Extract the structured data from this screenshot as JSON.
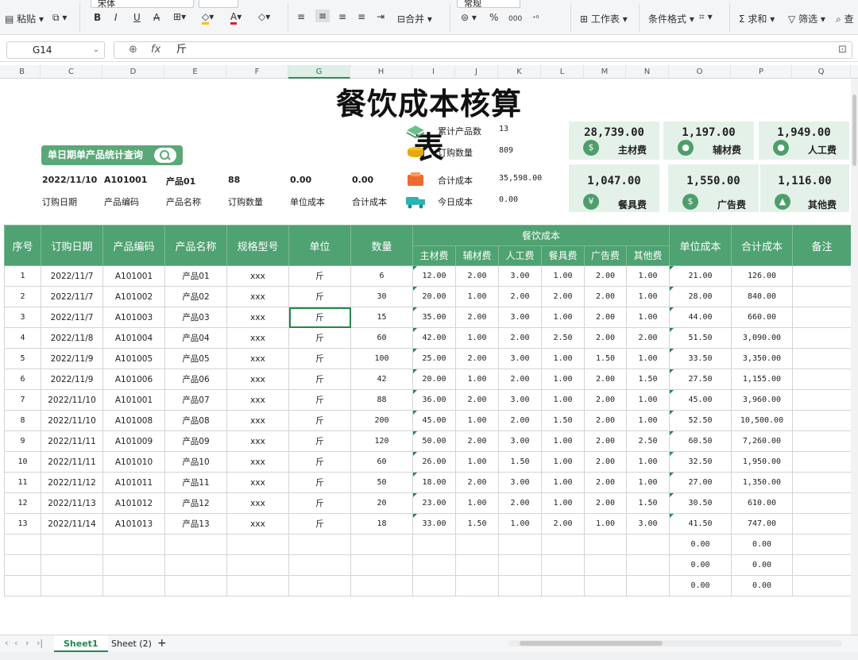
{
  "ribbon": {
    "paste_label": "粘贴",
    "font_name": "宋体",
    "merge_label": "合并",
    "number_format": "常规",
    "worksheet_label": "工作表",
    "cond_format_label": "条件格式",
    "sum_label": "求和",
    "filter_label": "筛选",
    "find_label": "查"
  },
  "formula_bar": {
    "cell_ref": "G14",
    "fx": "fx",
    "content": "斤"
  },
  "columns": [
    "B",
    "C",
    "D",
    "E",
    "F",
    "G",
    "H",
    "I",
    "J",
    "K",
    "L",
    "M",
    "N",
    "O",
    "P",
    "Q"
  ],
  "selected_column": "G",
  "title": "餐饮成本核算表",
  "query_button": "单日期单产品统计查询",
  "info": {
    "values": [
      "2022/11/10",
      "A101001",
      "产品01",
      "88",
      "0.00",
      "0.00"
    ],
    "labels": [
      "订购日期",
      "产品编码",
      "产品名称",
      "订购数量",
      "单位成本",
      "合计成本"
    ]
  },
  "stats": [
    {
      "label": "累计产品数",
      "value": "13"
    },
    {
      "label": "订购数量",
      "value": "809"
    },
    {
      "label": "合计成本",
      "value": "35,598.00"
    },
    {
      "label": "今日成本",
      "value": "0.00"
    }
  ],
  "cards": [
    {
      "value": "28,739.00",
      "label": "主材费",
      "icon": "$"
    },
    {
      "value": "1,197.00",
      "label": "辅材费",
      "icon": "●"
    },
    {
      "value": "1,949.00",
      "label": "人工费",
      "icon": "●"
    },
    {
      "value": "1,047.00",
      "label": "餐具费",
      "icon": "¥"
    },
    {
      "value": "1,550.00",
      "label": "广告费",
      "icon": "$"
    },
    {
      "value": "1,116.00",
      "label": "其他费",
      "icon": "▲"
    }
  ],
  "table": {
    "headers": [
      "序号",
      "订购日期",
      "产品编码",
      "产品名称",
      "规格型号",
      "单位",
      "数量",
      "餐饮成本",
      "单位成本",
      "合计成本",
      "备注"
    ],
    "sub_headers": [
      "主材费",
      "辅材费",
      "人工费",
      "餐具费",
      "广告费",
      "其他费"
    ],
    "rows": [
      [
        "1",
        "2022/11/7",
        "A101001",
        "产品01",
        "xxx",
        "斤",
        "6",
        "12.00",
        "2.00",
        "3.00",
        "1.00",
        "2.00",
        "1.00",
        "21.00",
        "126.00",
        ""
      ],
      [
        "2",
        "2022/11/7",
        "A101002",
        "产品02",
        "xxx",
        "斤",
        "30",
        "20.00",
        "1.00",
        "2.00",
        "2.00",
        "2.00",
        "1.00",
        "28.00",
        "840.00",
        ""
      ],
      [
        "3",
        "2022/11/7",
        "A101003",
        "产品03",
        "xxx",
        "斤",
        "15",
        "35.00",
        "2.00",
        "3.00",
        "1.00",
        "2.00",
        "1.00",
        "44.00",
        "660.00",
        ""
      ],
      [
        "4",
        "2022/11/8",
        "A101004",
        "产品04",
        "xxx",
        "斤",
        "60",
        "42.00",
        "1.00",
        "2.00",
        "2.50",
        "2.00",
        "2.00",
        "51.50",
        "3,090.00",
        ""
      ],
      [
        "5",
        "2022/11/9",
        "A101005",
        "产品05",
        "xxx",
        "斤",
        "100",
        "25.00",
        "2.00",
        "3.00",
        "1.00",
        "1.50",
        "1.00",
        "33.50",
        "3,350.00",
        ""
      ],
      [
        "6",
        "2022/11/9",
        "A101006",
        "产品06",
        "xxx",
        "斤",
        "42",
        "20.00",
        "1.00",
        "2.00",
        "1.00",
        "2.00",
        "1.50",
        "27.50",
        "1,155.00",
        ""
      ],
      [
        "7",
        "2022/11/10",
        "A101001",
        "产品07",
        "xxx",
        "斤",
        "88",
        "36.00",
        "2.00",
        "3.00",
        "1.00",
        "2.00",
        "1.00",
        "45.00",
        "3,960.00",
        ""
      ],
      [
        "8",
        "2022/11/10",
        "A101008",
        "产品08",
        "xxx",
        "斤",
        "200",
        "45.00",
        "1.00",
        "2.00",
        "1.50",
        "2.00",
        "1.00",
        "52.50",
        "10,500.00",
        ""
      ],
      [
        "9",
        "2022/11/11",
        "A101009",
        "产品09",
        "xxx",
        "斤",
        "120",
        "50.00",
        "2.00",
        "3.00",
        "1.00",
        "2.00",
        "2.50",
        "60.50",
        "7,260.00",
        ""
      ],
      [
        "10",
        "2022/11/11",
        "A101010",
        "产品10",
        "xxx",
        "斤",
        "60",
        "26.00",
        "1.00",
        "1.50",
        "1.00",
        "2.00",
        "1.00",
        "32.50",
        "1,950.00",
        ""
      ],
      [
        "11",
        "2022/11/12",
        "A101011",
        "产品11",
        "xxx",
        "斤",
        "50",
        "18.00",
        "2.00",
        "3.00",
        "1.00",
        "2.00",
        "1.00",
        "27.00",
        "1,350.00",
        ""
      ],
      [
        "12",
        "2022/11/13",
        "A101012",
        "产品12",
        "xxx",
        "斤",
        "20",
        "23.00",
        "1.00",
        "2.00",
        "1.00",
        "2.00",
        "1.50",
        "30.50",
        "610.00",
        ""
      ],
      [
        "13",
        "2022/11/14",
        "A101013",
        "产品13",
        "xxx",
        "斤",
        "18",
        "33.00",
        "1.50",
        "1.00",
        "2.00",
        "1.00",
        "3.00",
        "41.50",
        "747.00",
        ""
      ],
      [
        "",
        "",
        "",
        "",
        "",
        "",
        "",
        "",
        "",
        "",
        "",
        "",
        "",
        "0.00",
        "0.00",
        ""
      ],
      [
        "",
        "",
        "",
        "",
        "",
        "",
        "",
        "",
        "",
        "",
        "",
        "",
        "",
        "0.00",
        "0.00",
        ""
      ],
      [
        "",
        "",
        "",
        "",
        "",
        "",
        "",
        "",
        "",
        "",
        "",
        "",
        "",
        "0.00",
        "0.00",
        ""
      ]
    ]
  },
  "sheet_tabs": [
    "Sheet1",
    "Sheet (2)"
  ],
  "active_sheet": "Sheet1"
}
